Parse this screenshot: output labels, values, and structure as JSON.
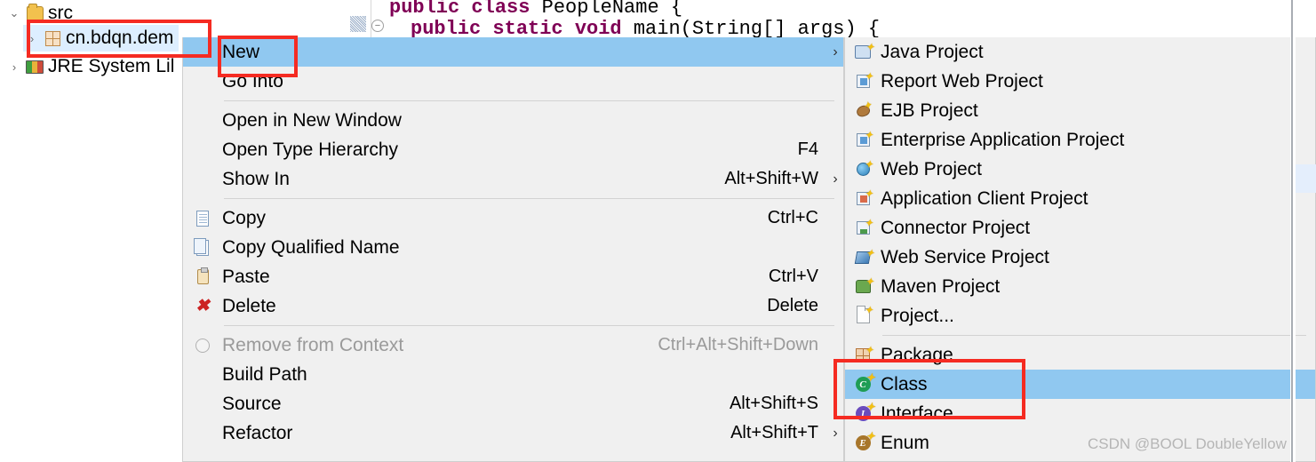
{
  "tree": {
    "rows": [
      {
        "arrow": "⌄",
        "icon": "source-folder-icon",
        "label": "src"
      },
      {
        "arrow": "›",
        "icon": "package-icon",
        "label": "cn.bdqn.dem"
      },
      {
        "arrow": "›",
        "icon": "jre-library-icon",
        "label": "JRE System Lil"
      }
    ]
  },
  "editor": {
    "line1_kw1": "public",
    "line1_kw2": "class",
    "line1_name": " PeopleName {",
    "line2_kw1": "public static void",
    "line2_rest": " main(String[] args) {"
  },
  "context_menu": {
    "items": [
      {
        "type": "item",
        "icon": "",
        "label": "New",
        "accel": "",
        "arrow": "›",
        "selected": true,
        "disabled": false
      },
      {
        "type": "item",
        "icon": "",
        "label": "Go Into",
        "accel": "",
        "arrow": "",
        "selected": false,
        "disabled": false
      },
      {
        "type": "separator"
      },
      {
        "type": "item",
        "icon": "",
        "label": "Open in New Window",
        "accel": "",
        "arrow": "",
        "selected": false,
        "disabled": false
      },
      {
        "type": "item",
        "icon": "",
        "label": "Open Type Hierarchy",
        "accel": "F4",
        "arrow": "",
        "selected": false,
        "disabled": false
      },
      {
        "type": "item",
        "icon": "",
        "label": "Show In",
        "accel": "Alt+Shift+W",
        "arrow": "›",
        "selected": false,
        "disabled": false
      },
      {
        "type": "separator"
      },
      {
        "type": "item",
        "icon": "copy-icon",
        "label": "Copy",
        "accel": "Ctrl+C",
        "arrow": "",
        "selected": false,
        "disabled": false
      },
      {
        "type": "item",
        "icon": "copy-qualified-icon",
        "label": "Copy Qualified Name",
        "accel": "",
        "arrow": "",
        "selected": false,
        "disabled": false
      },
      {
        "type": "item",
        "icon": "paste-icon",
        "label": "Paste",
        "accel": "Ctrl+V",
        "arrow": "",
        "selected": false,
        "disabled": false
      },
      {
        "type": "item",
        "icon": "delete-icon",
        "label": "Delete",
        "accel": "Delete",
        "arrow": "",
        "selected": false,
        "disabled": false
      },
      {
        "type": "separator"
      },
      {
        "type": "item",
        "icon": "remove-context-icon",
        "label": "Remove from Context",
        "accel": "Ctrl+Alt+Shift+Down",
        "arrow": "",
        "selected": false,
        "disabled": true
      },
      {
        "type": "item",
        "icon": "",
        "label": "Build Path",
        "accel": "",
        "arrow": "›",
        "selected": false,
        "disabled": false
      },
      {
        "type": "item",
        "icon": "",
        "label": "Source",
        "accel": "Alt+Shift+S",
        "arrow": "›",
        "selected": false,
        "disabled": false
      },
      {
        "type": "item",
        "icon": "",
        "label": "Refactor",
        "accel": "Alt+Shift+T",
        "arrow": "›",
        "selected": false,
        "disabled": false
      }
    ]
  },
  "submenu": {
    "items": [
      {
        "type": "item",
        "icon": "java-project-icon",
        "label": "Java Project",
        "selected": false
      },
      {
        "type": "item",
        "icon": "report-web-project-icon",
        "label": "Report Web Project",
        "selected": false
      },
      {
        "type": "item",
        "icon": "ejb-project-icon",
        "label": "EJB Project",
        "selected": false
      },
      {
        "type": "item",
        "icon": "enterprise-app-icon",
        "label": "Enterprise Application Project",
        "selected": false
      },
      {
        "type": "item",
        "icon": "web-project-icon",
        "label": "Web Project",
        "selected": false
      },
      {
        "type": "item",
        "icon": "app-client-project-icon",
        "label": "Application Client Project",
        "selected": false
      },
      {
        "type": "item",
        "icon": "connector-project-icon",
        "label": "Connector Project",
        "selected": false
      },
      {
        "type": "item",
        "icon": "web-service-project-icon",
        "label": "Web Service Project",
        "selected": false
      },
      {
        "type": "item",
        "icon": "maven-project-icon",
        "label": "Maven Project",
        "selected": false
      },
      {
        "type": "item",
        "icon": "generic-project-icon",
        "label": "Project...",
        "selected": false
      },
      {
        "type": "separator"
      },
      {
        "type": "item",
        "icon": "package-new-icon",
        "label": "Package",
        "selected": false
      },
      {
        "type": "item",
        "icon": "class-icon",
        "label": "Class",
        "selected": true
      },
      {
        "type": "item",
        "icon": "interface-icon",
        "label": "Interface",
        "selected": false
      },
      {
        "type": "item",
        "icon": "enum-icon",
        "label": "Enum",
        "selected": false
      }
    ]
  },
  "annotations": {
    "package_box": "highlight-package-node",
    "new_box": "highlight-new-menu-item",
    "class_box": "highlight-class-submenu-item"
  },
  "watermark": {
    "text": "CSDN @BOOL DoubleYellow"
  }
}
